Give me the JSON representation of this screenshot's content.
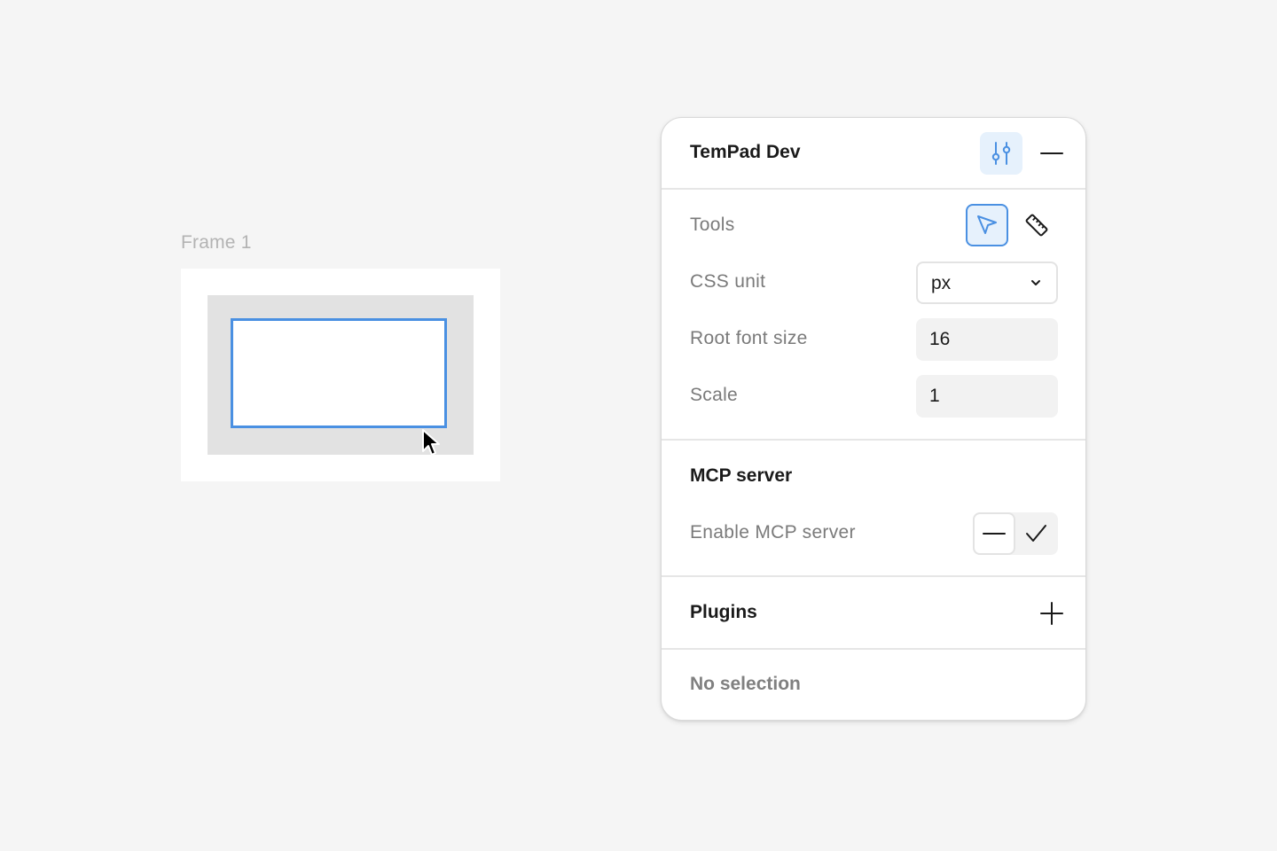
{
  "canvas": {
    "frame_label": "Frame 1"
  },
  "panel": {
    "title": "TemPad Dev",
    "header_icons": {
      "preferences": "sliders-icon",
      "minimize": "minus-icon"
    },
    "preferences": {
      "tools_label": "Tools",
      "tools": [
        {
          "name": "select",
          "icon": "pointer-icon",
          "active": true
        },
        {
          "name": "measure",
          "icon": "ruler-icon",
          "active": false
        }
      ],
      "css_unit_label": "CSS unit",
      "css_unit_value": "px",
      "root_font_size_label": "Root font size",
      "root_font_size_value": "16",
      "scale_label": "Scale",
      "scale_value": "1"
    },
    "mcp": {
      "title": "MCP server",
      "enable_label": "Enable MCP server",
      "enabled": false
    },
    "plugins": {
      "title": "Plugins",
      "add_icon": "plus-icon"
    },
    "inspect": {
      "empty_text": "No selection"
    }
  },
  "colors": {
    "accent": "#4a90e2",
    "accent_bg": "#e6f1fc",
    "canvas_bg": "#f5f5f5",
    "muted_text": "#7a7a7a"
  }
}
